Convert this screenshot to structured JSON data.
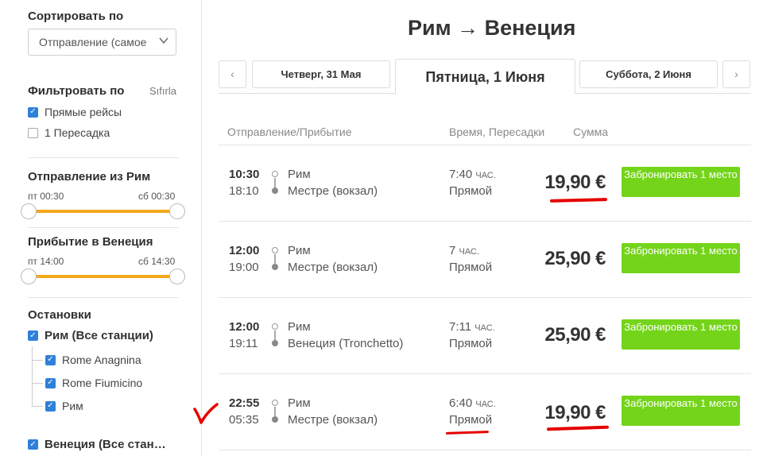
{
  "sidebar": {
    "sort_title": "Сортировать по",
    "sort_value": "Отправление (самое",
    "filter_title": "Фильтровать по",
    "reset_label": "Sıfırla",
    "direct_label": "Прямые рейсы",
    "transfer_label": "1 Пересадка",
    "departure_title": "Отправление из Рим",
    "departure_from": "пт 00:30",
    "departure_to": "сб 00:30",
    "arrival_title": "Прибытие в Венеция",
    "arrival_from": "пт 14:00",
    "arrival_to": "сб 14:30",
    "stops_title": "Остановки",
    "stops_rome_group": "Рим (Все станции)",
    "stops_rome_items": [
      "Rome Anagnina",
      "Rome Fiumicino",
      "Рим"
    ],
    "stops_venice_group": "Венеция (Все стан…"
  },
  "header": {
    "title": "Рим → Венеция",
    "prev_arrow": "‹",
    "next_arrow": "›",
    "tab_prev": "Четверг, 31 Мая",
    "tab_current": "Пятница, 1 Июня",
    "tab_next": "Суббота, 2 Июня"
  },
  "columns": {
    "route": "Отправление/Прибытие",
    "time": "Время, Пересадки",
    "sum": "Сумма"
  },
  "trips": [
    {
      "dep_time": "10:30",
      "arr_time": "18:10",
      "from": "Рим",
      "to": "Местре (вокзал)",
      "duration": "7:40",
      "unit": "ЧАС.",
      "transfers": "Прямой",
      "price": "19,90 €",
      "book": "Забронировать 1 место"
    },
    {
      "dep_time": "12:00",
      "arr_time": "19:00",
      "from": "Рим",
      "to": "Местре (вокзал)",
      "duration": "7",
      "unit": "ЧАС.",
      "transfers": "Прямой",
      "price": "25,90 €",
      "book": "Забронировать 1 место"
    },
    {
      "dep_time": "12:00",
      "arr_time": "19:11",
      "from": "Рим",
      "to": "Венеция (Tronchetto)",
      "duration": "7:11",
      "unit": "ЧАС.",
      "transfers": "Прямой",
      "price": "25,90 €",
      "book": "Забронировать 1 место"
    },
    {
      "dep_time": "22:55",
      "arr_time": "05:35",
      "from": "Рим",
      "to": "Местре (вокзал)",
      "duration": "6:40",
      "unit": "ЧАС.",
      "transfers": "Прямой",
      "price": "19,90 €",
      "book": "Забронировать 1 место"
    }
  ],
  "colors": {
    "accent_orange": "#f3a71b",
    "book_green": "#74d41a",
    "checkbox_blue": "#2f80d8",
    "annotation_red": "#e60000"
  }
}
